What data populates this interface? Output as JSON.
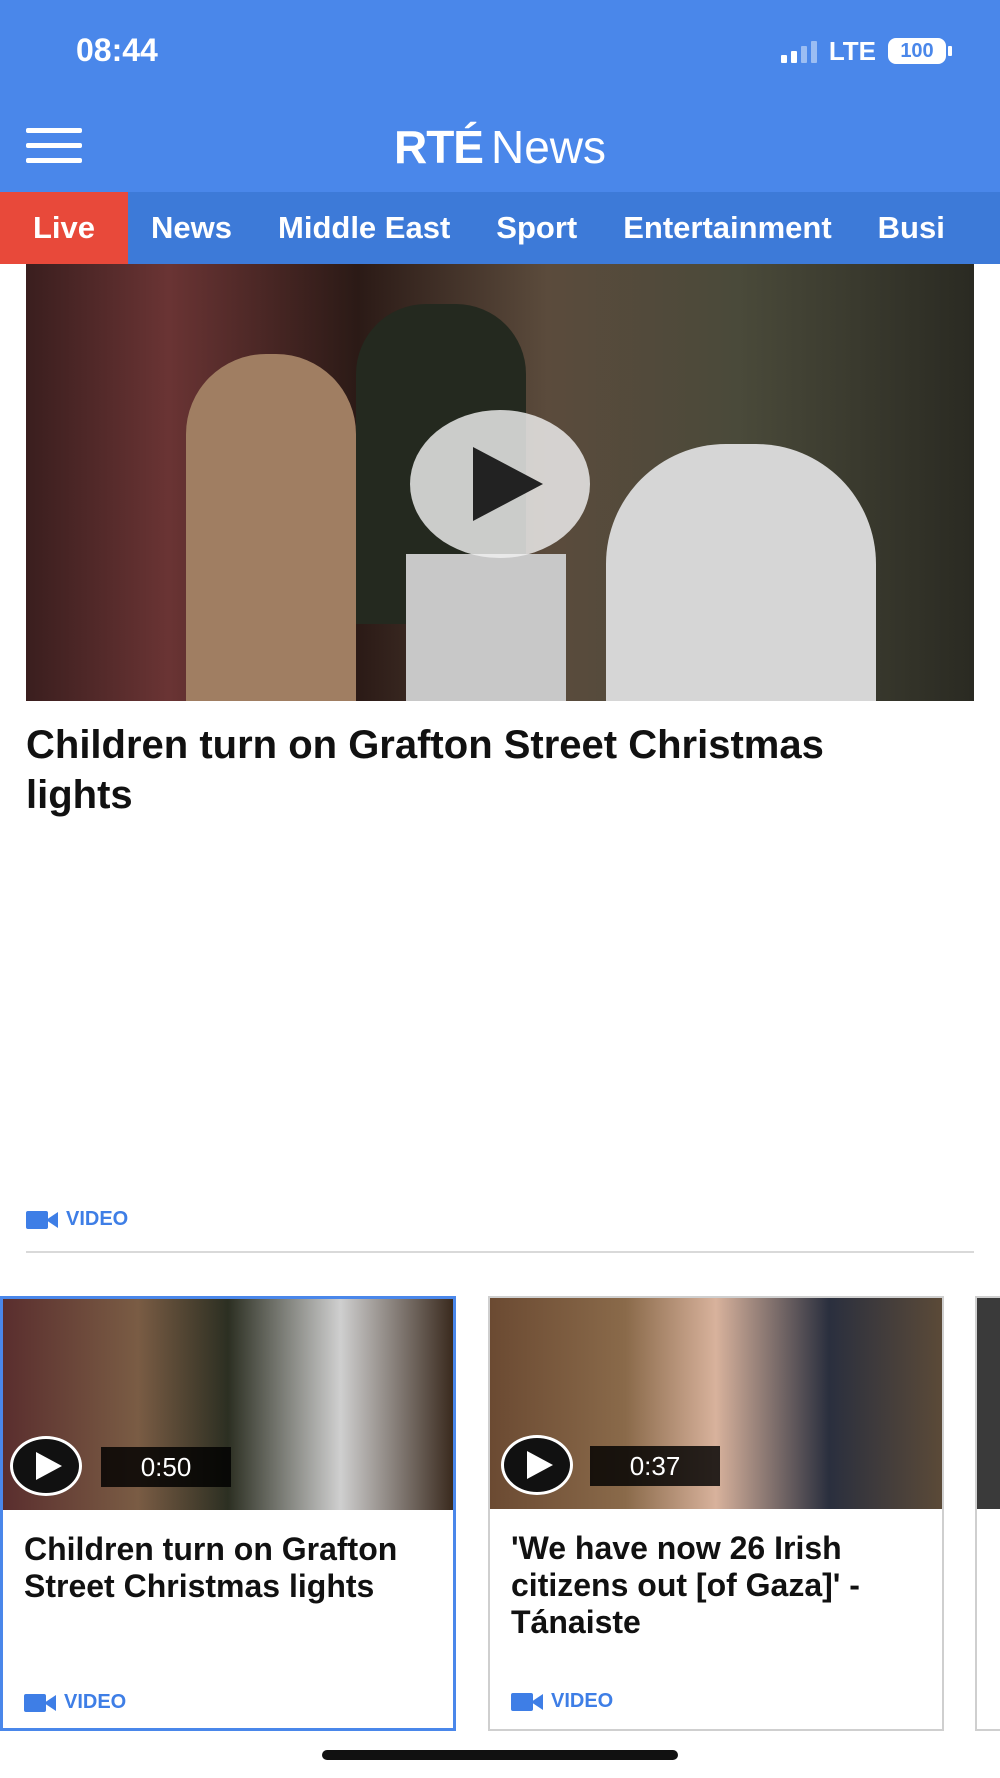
{
  "status_bar": {
    "time": "08:44",
    "network": "LTE",
    "battery": "100"
  },
  "header": {
    "logo_rte": "RTÉ",
    "logo_news": "News"
  },
  "tabs": [
    {
      "label": "Live"
    },
    {
      "label": "News"
    },
    {
      "label": "Middle East"
    },
    {
      "label": "Sport"
    },
    {
      "label": "Entertainment"
    },
    {
      "label": "Busi"
    }
  ],
  "hero": {
    "title": "Children turn on Grafton Street Christmas lights",
    "tag": "VIDEO"
  },
  "cards": [
    {
      "duration": "0:50",
      "title": "Children turn on Grafton Street Christmas lights",
      "tag": "VIDEO"
    },
    {
      "duration": "0:37",
      "title": "'We have now 26 Irish citizens out [of Gaza]' - Tánaiste",
      "tag": "VIDEO"
    }
  ],
  "colors": {
    "brand_blue": "#4a87ea",
    "tab_bar": "#3d7ad8",
    "live_red": "#e8493a",
    "tag_blue": "#3e7ee6"
  },
  "icons": {
    "menu": "menu-icon",
    "video": "video-camera-icon",
    "play": "play-icon"
  }
}
